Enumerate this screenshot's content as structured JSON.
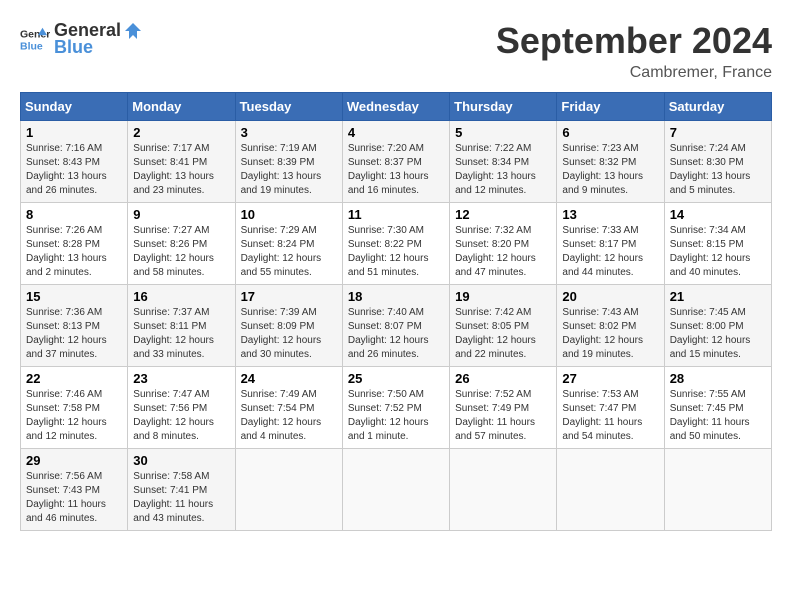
{
  "header": {
    "logo_general": "General",
    "logo_blue": "Blue",
    "month_title": "September 2024",
    "location": "Cambremer, France"
  },
  "calendar": {
    "days_of_week": [
      "Sunday",
      "Monday",
      "Tuesday",
      "Wednesday",
      "Thursday",
      "Friday",
      "Saturday"
    ],
    "weeks": [
      [
        {
          "day": "1",
          "sunrise": "7:16 AM",
          "sunset": "8:43 PM",
          "daylight": "13 hours and 26 minutes."
        },
        {
          "day": "2",
          "sunrise": "7:17 AM",
          "sunset": "8:41 PM",
          "daylight": "13 hours and 23 minutes."
        },
        {
          "day": "3",
          "sunrise": "7:19 AM",
          "sunset": "8:39 PM",
          "daylight": "13 hours and 19 minutes."
        },
        {
          "day": "4",
          "sunrise": "7:20 AM",
          "sunset": "8:37 PM",
          "daylight": "13 hours and 16 minutes."
        },
        {
          "day": "5",
          "sunrise": "7:22 AM",
          "sunset": "8:34 PM",
          "daylight": "13 hours and 12 minutes."
        },
        {
          "day": "6",
          "sunrise": "7:23 AM",
          "sunset": "8:32 PM",
          "daylight": "13 hours and 9 minutes."
        },
        {
          "day": "7",
          "sunrise": "7:24 AM",
          "sunset": "8:30 PM",
          "daylight": "13 hours and 5 minutes."
        }
      ],
      [
        {
          "day": "8",
          "sunrise": "7:26 AM",
          "sunset": "8:28 PM",
          "daylight": "13 hours and 2 minutes."
        },
        {
          "day": "9",
          "sunrise": "7:27 AM",
          "sunset": "8:26 PM",
          "daylight": "12 hours and 58 minutes."
        },
        {
          "day": "10",
          "sunrise": "7:29 AM",
          "sunset": "8:24 PM",
          "daylight": "12 hours and 55 minutes."
        },
        {
          "day": "11",
          "sunrise": "7:30 AM",
          "sunset": "8:22 PM",
          "daylight": "12 hours and 51 minutes."
        },
        {
          "day": "12",
          "sunrise": "7:32 AM",
          "sunset": "8:20 PM",
          "daylight": "12 hours and 47 minutes."
        },
        {
          "day": "13",
          "sunrise": "7:33 AM",
          "sunset": "8:17 PM",
          "daylight": "12 hours and 44 minutes."
        },
        {
          "day": "14",
          "sunrise": "7:34 AM",
          "sunset": "8:15 PM",
          "daylight": "12 hours and 40 minutes."
        }
      ],
      [
        {
          "day": "15",
          "sunrise": "7:36 AM",
          "sunset": "8:13 PM",
          "daylight": "12 hours and 37 minutes."
        },
        {
          "day": "16",
          "sunrise": "7:37 AM",
          "sunset": "8:11 PM",
          "daylight": "12 hours and 33 minutes."
        },
        {
          "day": "17",
          "sunrise": "7:39 AM",
          "sunset": "8:09 PM",
          "daylight": "12 hours and 30 minutes."
        },
        {
          "day": "18",
          "sunrise": "7:40 AM",
          "sunset": "8:07 PM",
          "daylight": "12 hours and 26 minutes."
        },
        {
          "day": "19",
          "sunrise": "7:42 AM",
          "sunset": "8:05 PM",
          "daylight": "12 hours and 22 minutes."
        },
        {
          "day": "20",
          "sunrise": "7:43 AM",
          "sunset": "8:02 PM",
          "daylight": "12 hours and 19 minutes."
        },
        {
          "day": "21",
          "sunrise": "7:45 AM",
          "sunset": "8:00 PM",
          "daylight": "12 hours and 15 minutes."
        }
      ],
      [
        {
          "day": "22",
          "sunrise": "7:46 AM",
          "sunset": "7:58 PM",
          "daylight": "12 hours and 12 minutes."
        },
        {
          "day": "23",
          "sunrise": "7:47 AM",
          "sunset": "7:56 PM",
          "daylight": "12 hours and 8 minutes."
        },
        {
          "day": "24",
          "sunrise": "7:49 AM",
          "sunset": "7:54 PM",
          "daylight": "12 hours and 4 minutes."
        },
        {
          "day": "25",
          "sunrise": "7:50 AM",
          "sunset": "7:52 PM",
          "daylight": "12 hours and 1 minute."
        },
        {
          "day": "26",
          "sunrise": "7:52 AM",
          "sunset": "7:49 PM",
          "daylight": "11 hours and 57 minutes."
        },
        {
          "day": "27",
          "sunrise": "7:53 AM",
          "sunset": "7:47 PM",
          "daylight": "11 hours and 54 minutes."
        },
        {
          "day": "28",
          "sunrise": "7:55 AM",
          "sunset": "7:45 PM",
          "daylight": "11 hours and 50 minutes."
        }
      ],
      [
        {
          "day": "29",
          "sunrise": "7:56 AM",
          "sunset": "7:43 PM",
          "daylight": "11 hours and 46 minutes."
        },
        {
          "day": "30",
          "sunrise": "7:58 AM",
          "sunset": "7:41 PM",
          "daylight": "11 hours and 43 minutes."
        },
        null,
        null,
        null,
        null,
        null
      ]
    ]
  }
}
